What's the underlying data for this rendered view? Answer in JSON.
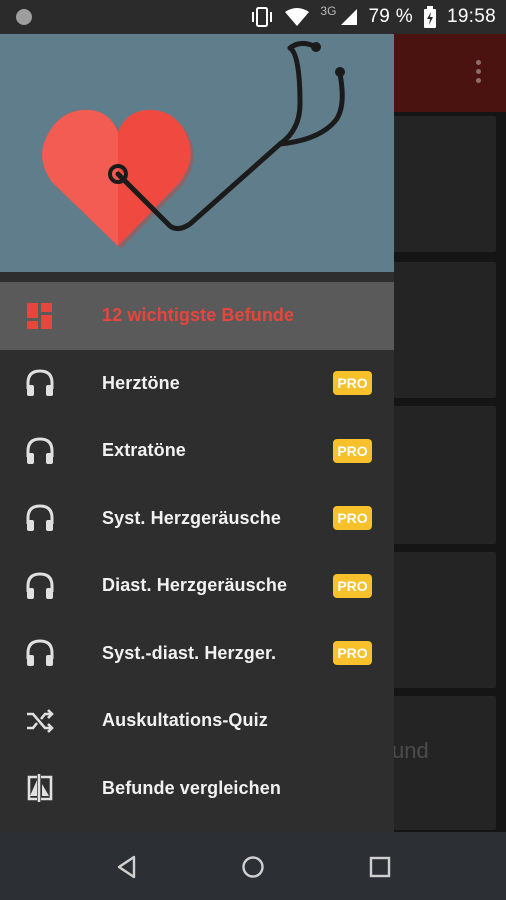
{
  "status_bar": {
    "network_type": "3G",
    "battery_percent": "79 %",
    "time": "19:58",
    "icons": [
      "notification-dot-icon",
      "vibrate-icon",
      "wifi-icon",
      "cellular-signal-icon",
      "battery-charging-icon"
    ]
  },
  "drawer": {
    "header_illustration": "heart-stethoscope",
    "items": [
      {
        "label": "12 wichtigste Befunde",
        "icon": "dashboard-icon",
        "active": true,
        "pro": ""
      },
      {
        "label": "Herztöne",
        "icon": "headphones-icon",
        "active": false,
        "pro": "PRO"
      },
      {
        "label": "Extratöne",
        "icon": "headphones-icon",
        "active": false,
        "pro": "PRO"
      },
      {
        "label": "Syst. Herzgeräusche",
        "icon": "headphones-icon",
        "active": false,
        "pro": "PRO"
      },
      {
        "label": "Diast. Herzgeräusche",
        "icon": "headphones-icon",
        "active": false,
        "pro": "PRO"
      },
      {
        "label": "Syst.-diast. Herzger.",
        "icon": "headphones-icon",
        "active": false,
        "pro": "PRO"
      },
      {
        "label": "Auskultations-Quiz",
        "icon": "shuffle-icon",
        "active": false,
        "pro": ""
      },
      {
        "label": "Befunde vergleichen",
        "icon": "compare-icon",
        "active": false,
        "pro": ""
      }
    ]
  },
  "background_app": {
    "partial_text": "und"
  },
  "colors": {
    "header_bg": "#607d8b",
    "drawer_bg": "#2e2e2e",
    "active_item_bg": "#5a5a5a",
    "active_accent": "#e8453c",
    "pro_badge": "#f6c12a",
    "toolbar_dimmed": "#4b1310"
  },
  "navigation_bar": {
    "buttons": [
      "back-icon",
      "home-icon",
      "recents-icon"
    ]
  }
}
